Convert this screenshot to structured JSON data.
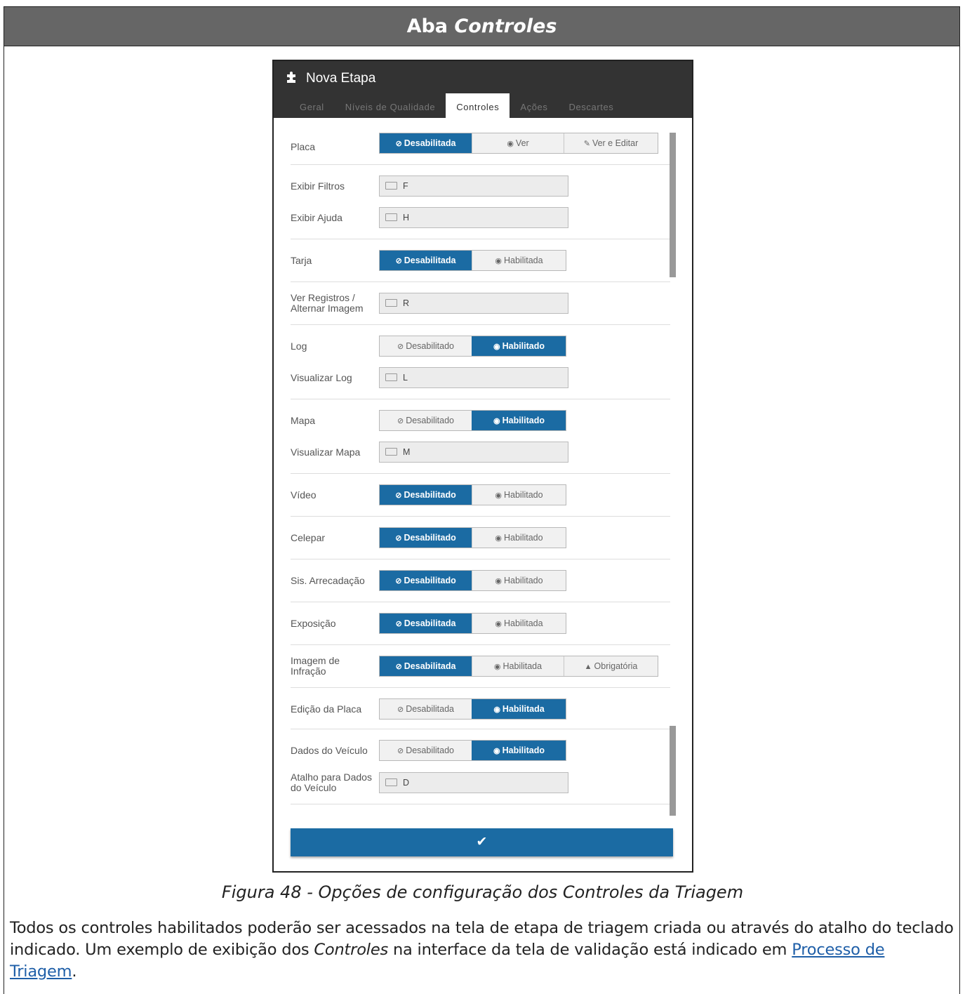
{
  "header": {
    "prefix": "Aba",
    "title_italic": "Controles"
  },
  "dialog": {
    "title": "Nova Etapa",
    "title_icon": "puzzle-icon",
    "tabs": [
      "Geral",
      "Níveis de Qualidade",
      "Controles",
      "Ações",
      "Descartes"
    ],
    "active_tab": "Controles",
    "submit_icon": "check-icon"
  },
  "controls": {
    "placa": {
      "label": "Placa",
      "options": [
        "Desabilitada",
        "Ver",
        "Ver e Editar"
      ],
      "selected": "Desabilitada"
    },
    "exibir_filtros": {
      "label": "Exibir Filtros",
      "key": "F"
    },
    "exibir_ajuda": {
      "label": "Exibir Ajuda",
      "key": "H"
    },
    "tarja": {
      "label": "Tarja",
      "options": [
        "Desabilitada",
        "Habilitada"
      ],
      "selected": "Desabilitada"
    },
    "ver_registros": {
      "label_line1": "Ver Registros /",
      "label_line2": "Alternar Imagem",
      "key": "R"
    },
    "log": {
      "label": "Log",
      "options": [
        "Desabilitado",
        "Habilitado"
      ],
      "selected": "Habilitado"
    },
    "visualizar_log": {
      "label": "Visualizar Log",
      "key": "L"
    },
    "mapa": {
      "label": "Mapa",
      "options": [
        "Desabilitado",
        "Habilitado"
      ],
      "selected": "Habilitado"
    },
    "visualizar_mapa": {
      "label": "Visualizar Mapa",
      "key": "M"
    },
    "video": {
      "label": "Vídeo",
      "options": [
        "Desabilitado",
        "Habilitado"
      ],
      "selected": "Desabilitado"
    },
    "celepar": {
      "label": "Celepar",
      "options": [
        "Desabilitado",
        "Habilitado"
      ],
      "selected": "Desabilitado"
    },
    "sis_arrecadacao": {
      "label": "Sis. Arrecadação",
      "options": [
        "Desabilitado",
        "Habilitado"
      ],
      "selected": "Desabilitado"
    },
    "exposicao": {
      "label": "Exposição",
      "options": [
        "Desabilitada",
        "Habilitada"
      ],
      "selected": "Desabilitada"
    },
    "imagem_infracao": {
      "label_line1": "Imagem de",
      "label_line2": "Infração",
      "options": [
        "Desabilitada",
        "Habilitada",
        "Obrigatória"
      ],
      "selected": "Desabilitada"
    },
    "edicao_placa": {
      "label": "Edição da Placa",
      "options": [
        "Desabilitada",
        "Habilitada"
      ],
      "selected": "Habilitada"
    },
    "dados_veiculo": {
      "label": "Dados do Veículo",
      "options": [
        "Desabilitado",
        "Habilitado"
      ],
      "selected": "Habilitado"
    },
    "atalho_dados": {
      "label_line1": "Atalho para Dados",
      "label_line2": "do Veículo",
      "key": "D"
    }
  },
  "caption": "Figura 48 - Opções de configuração dos Controles da Triagem",
  "paragraph": {
    "text1": "Todos os controles habilitados poderão ser acessados na tela de etapa de triagem criada ou através do atalho do teclado indicado. Um exemplo de exibição dos ",
    "italic": "Controles",
    "text2": " na interface da tela de validação está indicado em ",
    "link": "Processo de Triagem",
    "text3": "."
  }
}
